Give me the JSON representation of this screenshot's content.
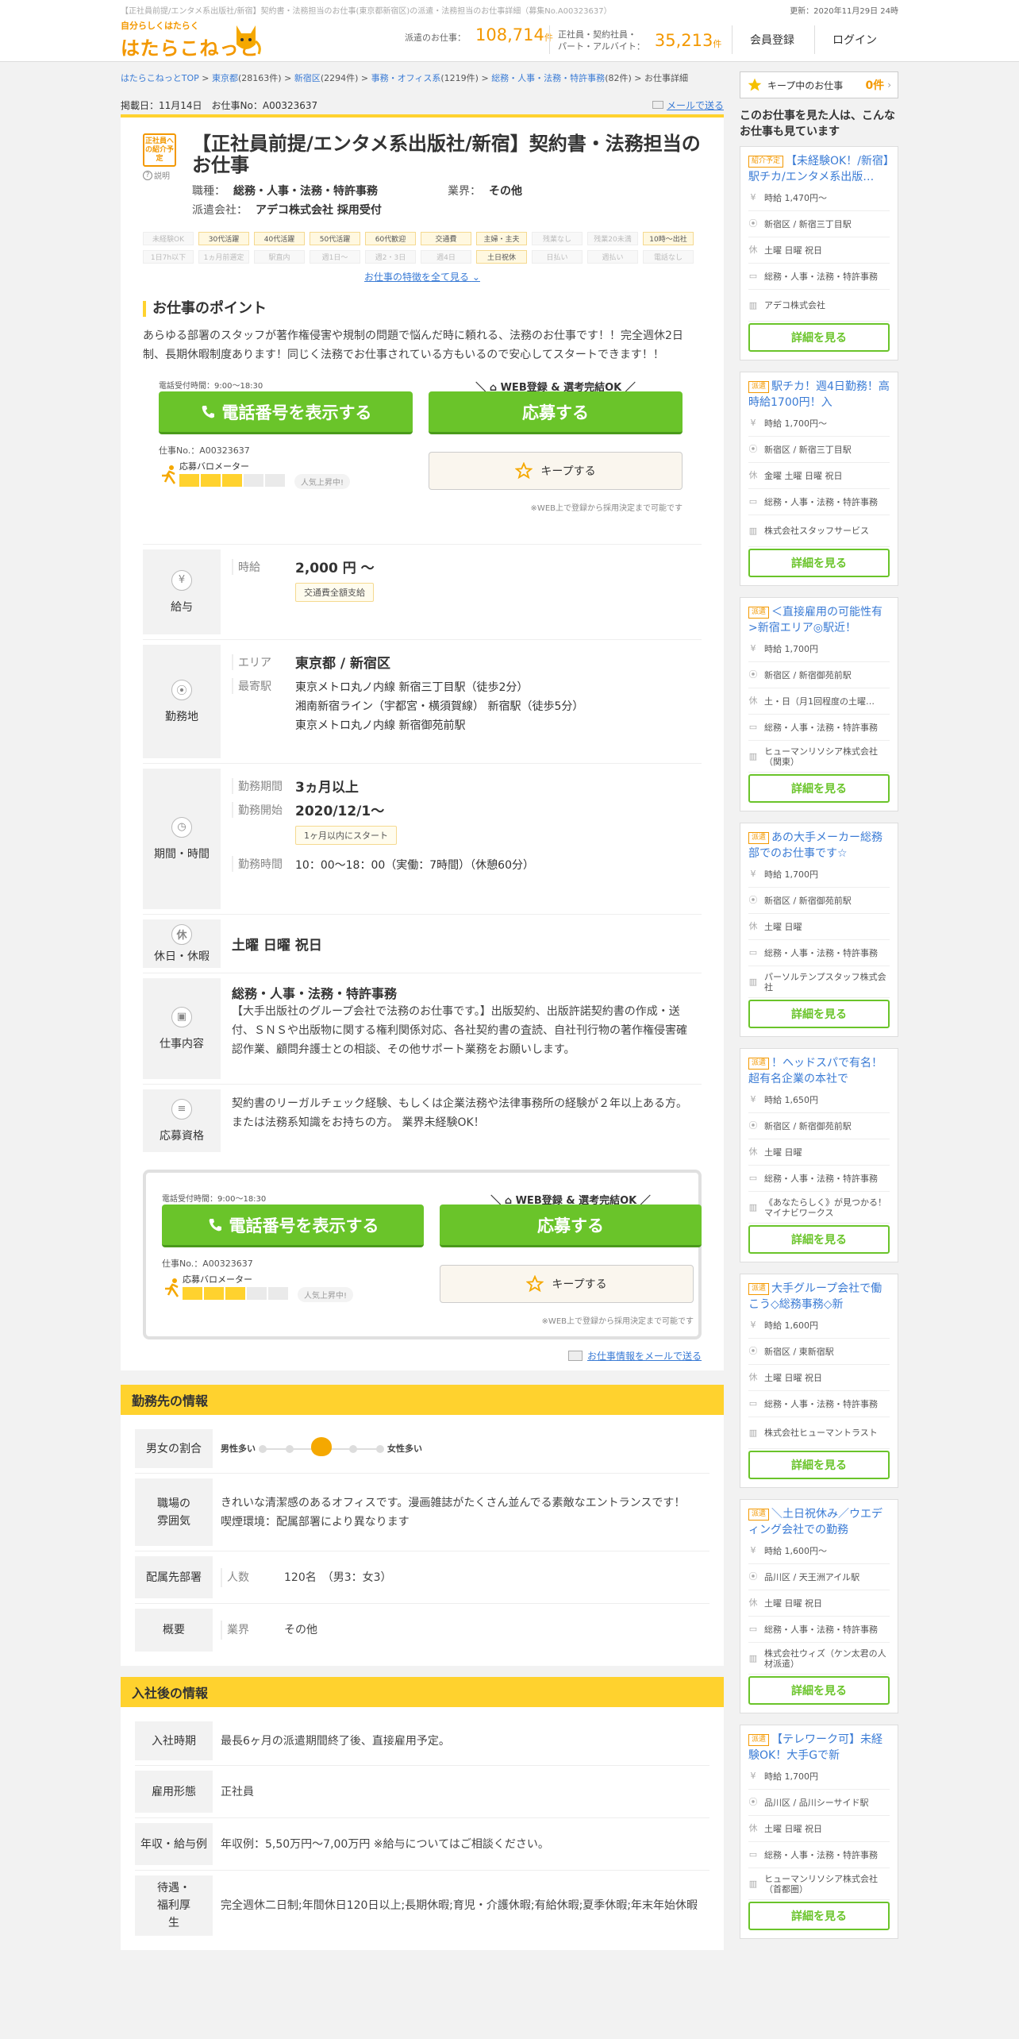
{
  "header": {
    "tagline": "【正社員前提/エンタメ系出版社/新宿】契約書・法務担当のお仕事(東京都新宿区)の派遣・法務担当のお仕事詳細（募集No.A00323637）",
    "logo_sub": "自分らしくはたらく",
    "logo_main": "はたらこねっと",
    "updated": "更新：2020年11月29日 24時",
    "stat1_label": "派遣のお仕事：",
    "stat1_num": "108,714",
    "stat1_unit": "件",
    "stat2_label1": "正社員・契約社員・",
    "stat2_label2": "パート・アルバイト：",
    "stat2_num": "35,213",
    "stat2_unit": "件",
    "register": "会員登録",
    "login": "ログイン"
  },
  "breadcrumb": {
    "items": [
      "はたらこねっとTOP",
      "東京都",
      "新宿区",
      "事務・オフィス系",
      "総務・人事・法務・特許事務"
    ],
    "counts": [
      "(28163件)",
      "(2294件)",
      "(1219件)",
      "(82件)"
    ],
    "current": "お仕事詳細",
    "sep": " > "
  },
  "meta": {
    "posted": "掲載日：11月14日　お仕事No：A00323637",
    "mail_send": "メールで送る"
  },
  "job": {
    "badge": "正社員への紹介予定",
    "badge_help": "説明",
    "title": "【正社員前提/エンタメ系出版社/新宿】契約書・法務担当のお仕事",
    "occupation_label": "職種：",
    "occupation": "総務・人事・法務・特許事務",
    "industry_label": "業界：",
    "industry": "その他",
    "agency_label": "派遣会社：",
    "agency": "アデコ株式会社 採用受付",
    "tags": [
      {
        "t": "未経験OK",
        "on": false
      },
      {
        "t": "30代活躍",
        "on": true
      },
      {
        "t": "40代活躍",
        "on": true
      },
      {
        "t": "50代活躍",
        "on": true
      },
      {
        "t": "60代歓迎",
        "on": true
      },
      {
        "t": "交通費",
        "on": true
      },
      {
        "t": "主婦・主夫",
        "on": true
      },
      {
        "t": "残業なし",
        "on": false
      },
      {
        "t": "残業20未満",
        "on": false
      },
      {
        "t": "10時～出社",
        "on": true
      },
      {
        "t": "1日7h以下",
        "on": false
      },
      {
        "t": "1ヵ月前選定",
        "on": false
      },
      {
        "t": "駅直内",
        "on": false
      },
      {
        "t": "週1日～",
        "on": false
      },
      {
        "t": "週2・3日",
        "on": false
      },
      {
        "t": "週4日",
        "on": false
      },
      {
        "t": "土日祝休",
        "on": true
      },
      {
        "t": "日払い",
        "on": false
      },
      {
        "t": "週払い",
        "on": false
      },
      {
        "t": "電話なし",
        "on": false
      }
    ],
    "more_features": "お仕事の特徴を全て見る"
  },
  "point": {
    "heading": "お仕事のポイント",
    "body": "あらゆる部署のスタッフが著作権侵害や規制の問題で悩んだ時に頼れる、法務のお仕事です！！完全週休2日制、長期休暇制度あります！同じく法務でお仕事されている方もいるので安心してスタートできます！！"
  },
  "cta": {
    "tel_hours": "電話受付時間：9:00～18:30",
    "tel_button": "電話番号を表示する",
    "job_no": "仕事No.：A00323637",
    "barometer_title": "応募バロメーター",
    "barometer_level": 3,
    "barometer_max": 5,
    "barometer_note": "人気上昇中!",
    "web_banner": "WEB登録 & 選考完結OK",
    "apply": "応募する",
    "keep": "キープする",
    "web_note": "※WEB上で登録から採用決定まで可能です"
  },
  "detail": {
    "salary_head": "給与",
    "wage_label": "時給",
    "wage": "2,000 円 ～",
    "wage_pill": "交通費全額支給",
    "place_head": "勤務地",
    "area_label": "エリア",
    "area": "東京都 / 新宿区",
    "station_label": "最寄駅",
    "stations": [
      "東京メトロ丸ノ内線 新宿三丁目駅（徒歩2分）",
      "湘南新宿ライン（宇都宮・横須賀線） 新宿駅（徒歩5分）",
      "東京メトロ丸ノ内線 新宿御苑前駅"
    ],
    "period_head": "期間・時間",
    "term_label": "勤務期間",
    "term": "3ヵ月以上",
    "start_label": "勤務開始",
    "start": "2020/12/1～",
    "start_pill": "1ヶ月以内にスタート",
    "hours_label": "勤務時間",
    "hours": "10：00～18：00（実働：7時間）（休憩60分）",
    "holiday_head": "休日・休暇",
    "holiday_icon": "休",
    "holiday": "土曜 日曜 祝日",
    "content_head": "仕事内容",
    "content_title": "総務・人事・法務・特許事務",
    "content_body": "【大手出版社のグループ会社で法務のお仕事です。】出版契約、出版許諾契約書の作成・送付、ＳＮＳや出版物に関する権利関係対応、各社契約書の査読、自社刊行物の著作権侵害確認作業、顧問弁護士との相談、その他サポート業務をお願いします。",
    "qual_head": "応募資格",
    "qual_body": "契約書のリーガルチェック経験、もしくは企業法務や法律事務所の経験が２年以上ある方。または法務系知識をお持ちの方。 業界未経験OK！"
  },
  "email_info": "お仕事情報をメールで送る",
  "office": {
    "heading": "勤務先の情報",
    "gender_head": "男女の割合",
    "male": "男性多い",
    "female": "女性多い",
    "gender_ratio": 0.5,
    "mood_head": "職場の雰囲気",
    "mood_body": "きれいな清潔感のあるオフィスです。漫画雑誌がたくさん並んでる素敵なエントランスです！",
    "smoke": "喫煙環境：配属部署により異なります",
    "dept_head": "配属先部署",
    "people_label": "人数",
    "people": "120名　（男3：女3）",
    "summary_head": "概要",
    "industry_label": "業界",
    "industry": "その他"
  },
  "hire": {
    "heading": "入社後の情報",
    "timing_head": "入社時期",
    "timing": "最長6ヶ月の派遣期間終了後、直接雇用予定。",
    "type_head": "雇用形態",
    "type": "正社員",
    "income_head": "年収・給与例",
    "income": "年収例：5,50万円～7,00万円 ※給与についてはご相談ください。",
    "welfare_head": "待遇・福利厚生",
    "welfare": "完全週休二日制;年間休日120日以上;長期休暇;育児・介護休暇;有給休暇;夏季休暇;年末年始休暇"
  },
  "sidebar": {
    "keep_label": "キープ中のお仕事",
    "keep_count": "0件",
    "rec_head": "このお仕事を見た人は、こんなお仕事も見ています",
    "detail_btn": "詳細を見る",
    "cards": [
      {
        "tag": "紹介予定",
        "title": "【未経験OK！/新宿】駅チカ/エンタメ系出版…",
        "wage": "時給 1,470円～",
        "place": "新宿区 / 新宿三丁目駅",
        "holiday": "土曜 日曜 祝日",
        "job": "総務・人事・法務・特許事務",
        "company": "アデコ株式会社"
      },
      {
        "tag": "派遣",
        "title": "駅チカ！週4日勤務！高時給1700円！入",
        "wage": "時給 1,700円～",
        "place": "新宿区 / 新宿三丁目駅",
        "holiday": "金曜 土曜 日曜 祝日",
        "job": "総務・人事・法務・特許事務",
        "company": "株式会社スタッフサービス"
      },
      {
        "tag": "派遣",
        "title": "＜直接雇用の可能性有>新宿エリア◎駅近！",
        "wage": "時給 1,700円",
        "place": "新宿区 / 新宿御苑前駅",
        "holiday": "土・日（月1回程度の土曜…",
        "job": "総務・人事・法務・特許事務",
        "company": "ヒューマンリソシア株式会社（関東）"
      },
      {
        "tag": "派遣",
        "title": "あの大手メーカー総務部でのお仕事です☆",
        "wage": "時給 1,700円",
        "place": "新宿区 / 新宿御苑前駅",
        "holiday": "土曜 日曜",
        "job": "総務・人事・法務・特許事務",
        "company": "パーソルテンプスタッフ株式会社"
      },
      {
        "tag": "派遣",
        "title": "！ヘッドスパで有名！超有名企業の本社で",
        "wage": "時給 1,650円",
        "place": "新宿区 / 新宿御苑前駅",
        "holiday": "土曜 日曜",
        "job": "総務・人事・法務・特許事務",
        "company": "《あなたらしく》が見つかる！ マイナビワークス"
      },
      {
        "tag": "派遣",
        "title": "大手グループ会社で働こう◇総務事務◇新",
        "wage": "時給 1,600円",
        "place": "新宿区 / 東新宿駅",
        "holiday": "土曜 日曜 祝日",
        "job": "総務・人事・法務・特許事務",
        "company": "株式会社ヒューマントラスト"
      },
      {
        "tag": "派遣",
        "title": "＼土日祝休み／ウエディング会社での勤務",
        "wage": "時給 1,600円～",
        "place": "品川区 / 天王洲アイル駅",
        "holiday": "土曜 日曜 祝日",
        "job": "総務・人事・法務・特許事務",
        "company": "株式会社ウィズ（ケン太君の人材派遣）"
      },
      {
        "tag": "派遣",
        "title": "【テレワーク可】未経験OK！大手Gで新",
        "wage": "時給 1,700円",
        "place": "品川区 / 品川シーサイド駅",
        "holiday": "土曜 日曜 祝日",
        "job": "総務・人事・法務・特許事務",
        "company": "ヒューマンリソシア株式会社（首都圏）"
      }
    ]
  }
}
